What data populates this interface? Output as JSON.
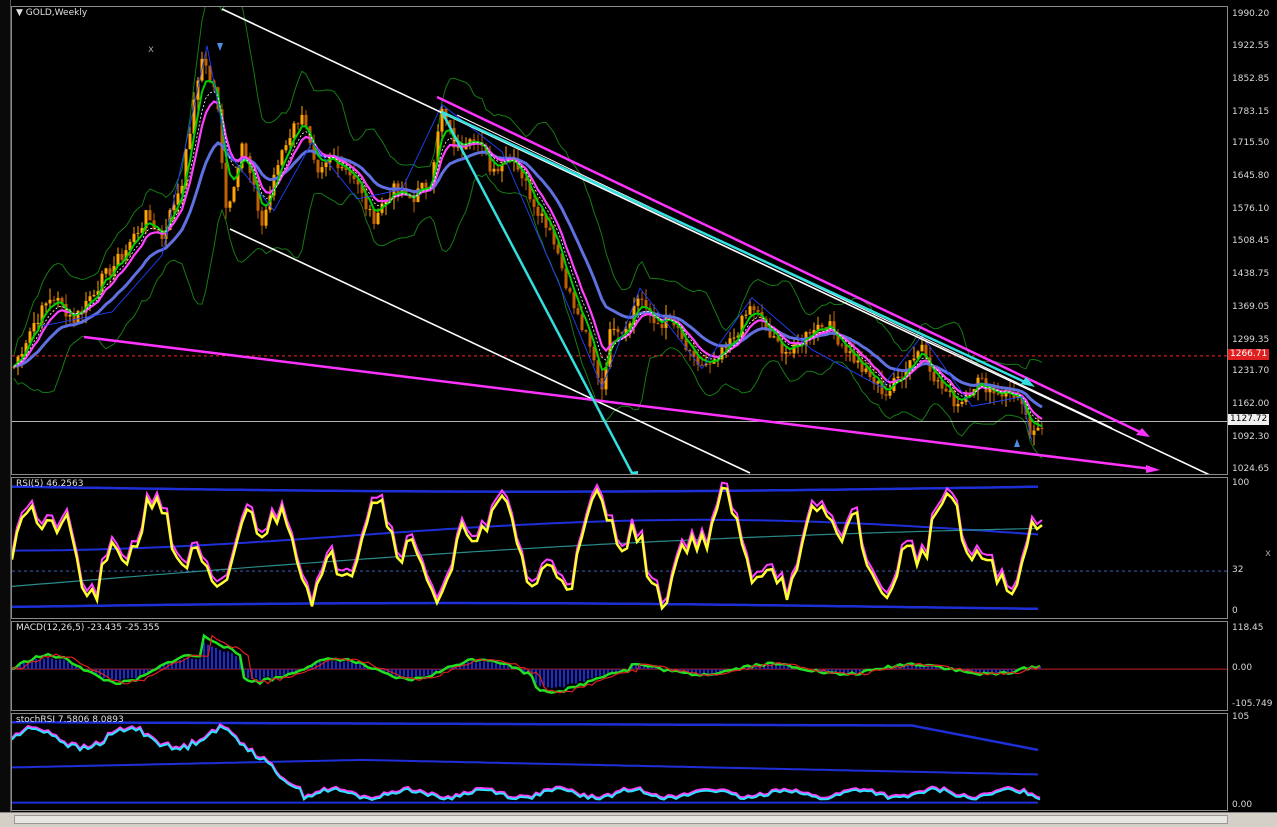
{
  "main": {
    "title": "GOLD,Weekly",
    "close_marker": "x",
    "ticks": [
      "1990.20",
      "1922.55",
      "1852.85",
      "1783.15",
      "1715.50",
      "1645.80",
      "1576.10",
      "1508.45",
      "1438.75",
      "1369.05",
      "1299.35",
      "1231.70",
      "1162.00",
      "1092.30",
      "1024.65"
    ],
    "tick_values": [
      1990.2,
      1922.55,
      1852.85,
      1783.15,
      1715.5,
      1645.8,
      1576.1,
      1508.45,
      1438.75,
      1369.05,
      1299.35,
      1231.7,
      1162.0,
      1092.3,
      1024.65
    ],
    "current_price": "1127.72",
    "resistance_level": "1266.71",
    "colors": {
      "bull": "#ffa500",
      "bear": "#c06000",
      "ema_fast": "#00d000",
      "ema_mid": "#ff40ff",
      "ema_slow": "#6070e0",
      "band": "#157a15",
      "fib_line": "#ffffff",
      "trend_magenta": "#ff33ff",
      "trend_cyan": "#33e0e0",
      "resistance": "#ff2020"
    }
  },
  "rsi": {
    "title": "RSI(5) 46.2563",
    "ticks": [
      "100",
      "32",
      "0"
    ],
    "tick_values": [
      100,
      32,
      0
    ]
  },
  "macd": {
    "title": "MACD(12,26,5) -23.435 -25.355",
    "ticks": [
      "118.45",
      "0.00",
      "-105.749"
    ],
    "tick_values": [
      118.45,
      0,
      -105.749
    ]
  },
  "stoch": {
    "title": "stochRSI 7.5806 8.0893",
    "ticks": [
      "105",
      "0.00"
    ],
    "tick_values": [
      105,
      0
    ]
  },
  "side_marker": "x",
  "chart_data": {
    "type": "candlestick",
    "title": "GOLD,Weekly",
    "series_anchors_price": [
      [
        0,
        1235
      ],
      [
        20,
        1330
      ],
      [
        40,
        1395
      ],
      [
        62,
        1345
      ],
      [
        85,
        1415
      ],
      [
        110,
        1480
      ],
      [
        135,
        1565
      ],
      [
        150,
        1520
      ],
      [
        170,
        1640
      ],
      [
        190,
        1905
      ],
      [
        205,
        1810
      ],
      [
        215,
        1565
      ],
      [
        230,
        1720
      ],
      [
        250,
        1545
      ],
      [
        270,
        1705
      ],
      [
        290,
        1785
      ],
      [
        305,
        1640
      ],
      [
        320,
        1690
      ],
      [
        340,
        1655
      ],
      [
        360,
        1555
      ],
      [
        380,
        1620
      ],
      [
        400,
        1600
      ],
      [
        418,
        1640
      ],
      [
        430,
        1785
      ],
      [
        445,
        1700
      ],
      [
        460,
        1745
      ],
      [
        480,
        1660
      ],
      [
        500,
        1700
      ],
      [
        520,
        1600
      ],
      [
        540,
        1530
      ],
      [
        560,
        1380
      ],
      [
        575,
        1300
      ],
      [
        590,
        1200
      ],
      [
        600,
        1340
      ],
      [
        612,
        1320
      ],
      [
        628,
        1400
      ],
      [
        640,
        1335
      ],
      [
        660,
        1340
      ],
      [
        680,
        1255
      ],
      [
        700,
        1240
      ],
      [
        720,
        1300
      ],
      [
        740,
        1375
      ],
      [
        760,
        1300
      ],
      [
        780,
        1270
      ],
      [
        800,
        1330
      ],
      [
        815,
        1335
      ],
      [
        835,
        1280
      ],
      [
        855,
        1225
      ],
      [
        875,
        1185
      ],
      [
        895,
        1250
      ],
      [
        910,
        1290
      ],
      [
        925,
        1210
      ],
      [
        945,
        1165
      ],
      [
        965,
        1215
      ],
      [
        985,
        1190
      ],
      [
        1005,
        1185
      ],
      [
        1020,
        1090
      ],
      [
        1030,
        1115
      ],
      [
        1040,
        1145
      ]
    ]
  }
}
